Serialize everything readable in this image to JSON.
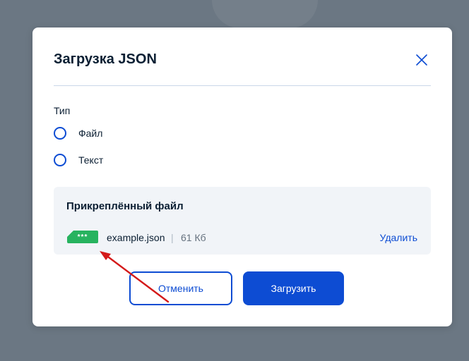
{
  "modal": {
    "title": "Загрузка JSON"
  },
  "type_field": {
    "label": "Тип",
    "options": [
      {
        "label": "Файл",
        "selected": false
      },
      {
        "label": "Текст",
        "selected": false
      }
    ]
  },
  "attached_file": {
    "title": "Прикреплённый файл",
    "badge_text": "***",
    "file_name": "example.json",
    "separator": "|",
    "file_size": "61 Кб",
    "delete_label": "Удалить"
  },
  "buttons": {
    "cancel_label": "Отменить",
    "upload_label": "Загрузить"
  },
  "colors": {
    "primary": "#0d4cd3",
    "badge": "#27b35f",
    "annotation_arrow": "#d41a1a",
    "overlay": "#6b7783"
  },
  "icons": {
    "close": "close-icon",
    "annotation": "arrow-annotation"
  }
}
